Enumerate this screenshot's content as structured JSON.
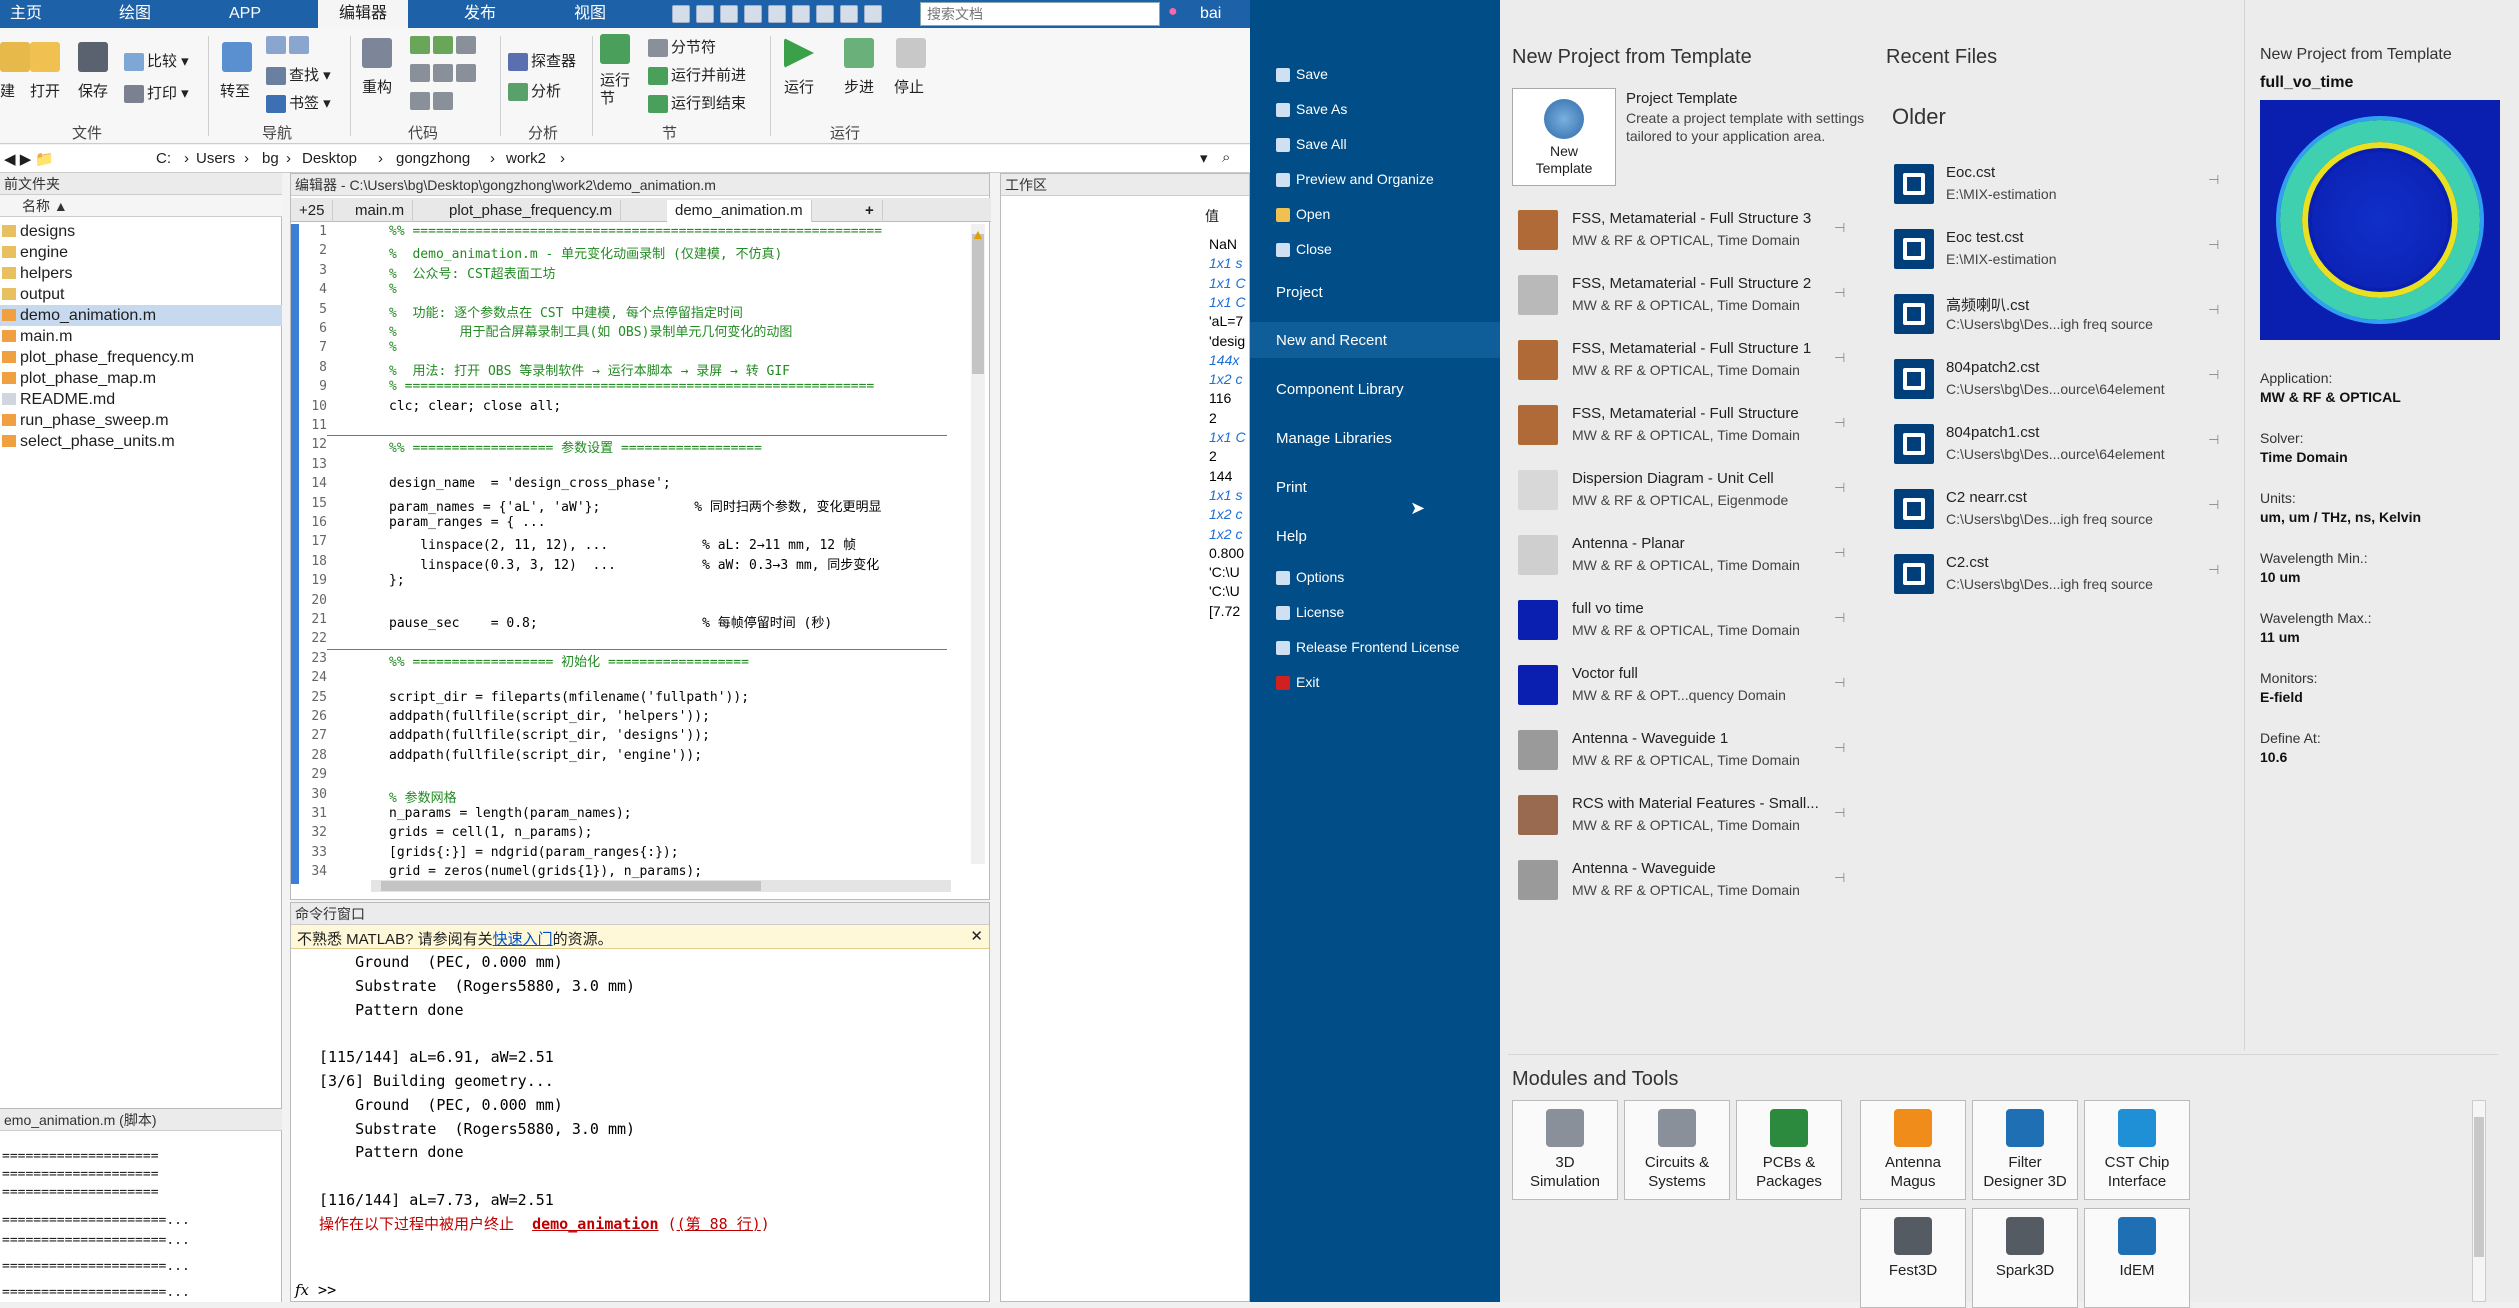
{
  "matlab": {
    "tabs": [
      "主页",
      "绘图",
      "APP",
      "编辑器",
      "发布",
      "视图"
    ],
    "search_placeholder": "搜索文档",
    "user": "bai",
    "ribbon": {
      "file": {
        "new": "建",
        "open": "打开",
        "save": "保存",
        "compare": "比较",
        "print": "打印",
        "group": "文件"
      },
      "nav": {
        "goto": "转至",
        "find": "查找",
        "bookmark": "书签",
        "group": "导航"
      },
      "code": {
        "refactor": "重构",
        "group": "代码"
      },
      "analyze": {
        "profiler": "探查器",
        "analyze": "分析",
        "group": "分析"
      },
      "section": {
        "run_section": "运行节",
        "section_break": "分节符",
        "run_advance": "运行并前进",
        "run_to_end": "运行到结束",
        "group": "节"
      },
      "run": {
        "run": "运行",
        "step": "步进",
        "stop": "停止",
        "group": "运行"
      }
    },
    "address": [
      "C:",
      "Users",
      "bg",
      "Desktop",
      "gongzhong",
      "work2"
    ],
    "files": {
      "header": "前文件夹",
      "col": "名称",
      "items": [
        "designs",
        "engine",
        "helpers",
        "output",
        "demo_animation.m",
        "main.m",
        "plot_phase_frequency.m",
        "plot_phase_map.m",
        "README.md",
        "run_phase_sweep.m",
        "select_phase_units.m"
      ]
    },
    "details": {
      "title": "emo_animation.m  (脚本)",
      "lines": [
        "====================",
        "====================",
        "====================",
        "=====================...",
        "=====================...",
        "=====================...",
        "=====================..."
      ]
    },
    "editor": {
      "title": "编辑器 - C:\\Users\\bg\\Desktop\\gongzhong\\work2\\demo_animation.m",
      "tabs": [
        "+25",
        "main.m",
        "plot_phase_frequency.m",
        "demo_animation.m"
      ],
      "lines": [
        {
          "n": "1",
          "t": "%% ============================================================",
          "c": "cm"
        },
        {
          "n": "2",
          "t": "%  demo_animation.m - 单元变化动画录制 (仅建模, 不仿真)",
          "c": "cm"
        },
        {
          "n": "3",
          "t": "%  公众号: CST超表面工坊",
          "c": "cm"
        },
        {
          "n": "4",
          "t": "%",
          "c": "cm"
        },
        {
          "n": "5",
          "t": "%  功能: 逐个参数点在 CST 中建模, 每个点停留指定时间",
          "c": "cm"
        },
        {
          "n": "6",
          "t": "%        用于配合屏幕录制工具(如 OBS)录制单元几何变化的动图",
          "c": "cm"
        },
        {
          "n": "7",
          "t": "%",
          "c": "cm"
        },
        {
          "n": "8",
          "t": "%  用法: 打开 OBS 等录制软件 → 运行本脚本 → 录屏 → 转 GIF",
          "c": "cm"
        },
        {
          "n": "9",
          "t": "% ============================================================",
          "c": "cm"
        },
        {
          "n": "10",
          "t": "clc; clear; close all;",
          "c": ""
        },
        {
          "n": "11",
          "t": "",
          "c": ""
        },
        {
          "n": "12",
          "t": "%% ================== 参数设置 ==================",
          "c": "cm"
        },
        {
          "n": "13",
          "t": "",
          "c": ""
        },
        {
          "n": "14",
          "t": "design_name  = 'design_cross_phase';",
          "c": ""
        },
        {
          "n": "15",
          "t": "param_names = {'aL', 'aW'};            % 同时扫两个参数, 变化更明显",
          "c": ""
        },
        {
          "n": "16",
          "t": "param_ranges = { ...",
          "c": ""
        },
        {
          "n": "17",
          "t": "    linspace(2, 11, 12), ...            % aL: 2→11 mm, 12 帧",
          "c": ""
        },
        {
          "n": "18",
          "t": "    linspace(0.3, 3, 12)  ...           % aW: 0.3→3 mm, 同步变化",
          "c": ""
        },
        {
          "n": "19",
          "t": "};",
          "c": ""
        },
        {
          "n": "20",
          "t": "",
          "c": ""
        },
        {
          "n": "21",
          "t": "pause_sec    = 0.8;                     % 每帧停留时间 (秒)",
          "c": ""
        },
        {
          "n": "22",
          "t": "",
          "c": ""
        },
        {
          "n": "23",
          "t": "%% ================== 初始化 ==================",
          "c": "cm"
        },
        {
          "n": "24",
          "t": "",
          "c": ""
        },
        {
          "n": "25",
          "t": "script_dir = fileparts(mfilename('fullpath'));",
          "c": ""
        },
        {
          "n": "26",
          "t": "addpath(fullfile(script_dir, 'helpers'));",
          "c": ""
        },
        {
          "n": "27",
          "t": "addpath(fullfile(script_dir, 'designs'));",
          "c": ""
        },
        {
          "n": "28",
          "t": "addpath(fullfile(script_dir, 'engine'));",
          "c": ""
        },
        {
          "n": "29",
          "t": "",
          "c": ""
        },
        {
          "n": "30",
          "t": "% 参数网格",
          "c": "cm"
        },
        {
          "n": "31",
          "t": "n_params = length(param_names);",
          "c": ""
        },
        {
          "n": "32",
          "t": "grids = cell(1, n_params);",
          "c": ""
        },
        {
          "n": "33",
          "t": "[grids{:}] = ndgrid(param_ranges{:});",
          "c": ""
        },
        {
          "n": "34",
          "t": "grid = zeros(numel(grids{1}), n_params);",
          "c": ""
        }
      ]
    },
    "command": {
      "title": "命令行窗口",
      "notice_pre": "不熟悉 MATLAB? 请参阅有关",
      "notice_link": "快速入门",
      "notice_post": "的资源。",
      "lines": [
        "    Ground  (PEC, 0.000 mm)",
        "    Substrate  (Rogers5880, 3.0 mm)",
        "    Pattern done",
        "",
        "[115/144] aL=6.91, aW=2.51",
        "[3/6] Building geometry...",
        "    Ground  (PEC, 0.000 mm)",
        "    Substrate  (Rogers5880, 3.0 mm)",
        "    Pattern done",
        "",
        "[116/144] aL=7.73, aW=2.51"
      ],
      "error_pre": "操作在以下过程中被用户终止",
      "error_fn": "demo_animation",
      "error_line": "(第 88 行)",
      "prompt": ">>"
    },
    "workspace": {
      "title": "工作区",
      "col": "值",
      "values": [
        {
          "v": "NaN",
          "k": "b"
        },
        {
          "v": "1x1 s",
          "k": "v"
        },
        {
          "v": "1x1 C",
          "k": "v"
        },
        {
          "v": "1x1 C",
          "k": "v"
        },
        {
          "v": "'aL=7",
          "k": "b"
        },
        {
          "v": "'desig",
          "k": "b"
        },
        {
          "v": "144x",
          "k": "v"
        },
        {
          "v": "1x2 c",
          "k": "v"
        },
        {
          "v": "116",
          "k": "b"
        },
        {
          "v": "2",
          "k": "b"
        },
        {
          "v": "1x1 C",
          "k": "v"
        },
        {
          "v": "2",
          "k": "b"
        },
        {
          "v": "144",
          "k": "b"
        },
        {
          "v": "1x1 s",
          "k": "v"
        },
        {
          "v": "1x2 c",
          "k": "v"
        },
        {
          "v": "1x2 c",
          "k": "v"
        },
        {
          "v": "0.800",
          "k": "b"
        },
        {
          "v": "'C:\\U",
          "k": "b"
        },
        {
          "v": "'C:\\U",
          "k": "b"
        },
        {
          "v": "[7.72",
          "k": "b"
        }
      ]
    }
  },
  "cst": {
    "menu": {
      "save": "Save",
      "save_as": "Save As",
      "save_all": "Save All",
      "preview": "Preview and Organize",
      "open": "Open",
      "close": "Close",
      "project": "Project",
      "new_recent": "New and Recent",
      "component_library": "Component Library",
      "manage_libraries": "Manage Libraries",
      "print": "Print",
      "help": "Help",
      "options": "Options",
      "license": "License",
      "release_license": "Release Frontend License",
      "exit": "Exit"
    },
    "templates_title": "New Project from Template",
    "new_template": {
      "label": "New Template",
      "title": "Project Template",
      "desc1": "Create a project template with settings",
      "desc2": "tailored to your application area."
    },
    "templates": [
      {
        "t": "FSS, Metamaterial - Full Structure 3",
        "s": "MW & RF & OPTICAL, Time Domain",
        "c": "#b06a38"
      },
      {
        "t": "FSS, Metamaterial - Full Structure 2",
        "s": "MW & RF & OPTICAL, Time Domain",
        "c": "#b9b9b9"
      },
      {
        "t": "FSS, Metamaterial - Full Structure 1",
        "s": "MW & RF & OPTICAL, Time Domain",
        "c": "#b06a38"
      },
      {
        "t": "FSS, Metamaterial - Full Structure",
        "s": "MW & RF & OPTICAL, Time Domain",
        "c": "#b06a38"
      },
      {
        "t": "Dispersion Diagram - Unit Cell",
        "s": "MW & RF & OPTICAL, Eigenmode",
        "c": "#d8d8d8"
      },
      {
        "t": "Antenna - Planar",
        "s": "MW & RF & OPTICAL, Time Domain",
        "c": "#cfcfcf"
      },
      {
        "t": "full vo time",
        "s": "MW & RF & OPTICAL, Time Domain",
        "c": "#0a1fb0"
      },
      {
        "t": "Voctor full",
        "s": "MW & RF & OPT...quency Domain",
        "c": "#0a1fb0"
      },
      {
        "t": "Antenna - Waveguide 1",
        "s": "MW & RF & OPTICAL, Time Domain",
        "c": "#9a9a9a"
      },
      {
        "t": "RCS with Material Features - Small...",
        "s": "MW & RF & OPTICAL, Time Domain",
        "c": "#9a6a50"
      },
      {
        "t": "Antenna - Waveguide",
        "s": "MW & RF & OPTICAL, Time Domain",
        "c": "#9a9a9a"
      }
    ],
    "recent_title": "Recent Files",
    "older_label": "Older",
    "recent": [
      {
        "t": "Eoc.cst",
        "s": "E:\\MIX-estimation"
      },
      {
        "t": "Eoc test.cst",
        "s": "E:\\MIX-estimation"
      },
      {
        "t": "高频喇叭.cst",
        "s": "C:\\Users\\bg\\Des...igh freq source"
      },
      {
        "t": "804patch2.cst",
        "s": "C:\\Users\\bg\\Des...ource\\64element"
      },
      {
        "t": "804patch1.cst",
        "s": "C:\\Users\\bg\\Des...ource\\64element"
      },
      {
        "t": "C2 nearr.cst",
        "s": "C:\\Users\\bg\\Des...igh freq source"
      },
      {
        "t": "C2.cst",
        "s": "C:\\Users\\bg\\Des...igh freq source"
      }
    ],
    "detail": {
      "header": "New Project from Template",
      "name": "full_vo_time",
      "fields": [
        {
          "l": "Application:",
          "v": "MW & RF & OPTICAL"
        },
        {
          "l": "Solver:",
          "v": "Time Domain"
        },
        {
          "l": "Units:",
          "v": "um, um / THz, ns, Kelvin"
        },
        {
          "l": "Wavelength Min.:",
          "v": "10 um"
        },
        {
          "l": "Wavelength Max.:",
          "v": "11 um"
        },
        {
          "l": "Monitors:",
          "v": "E-field"
        },
        {
          "l": "Define At:",
          "v": "10.6"
        }
      ]
    },
    "modules_title": "Modules and Tools",
    "tools": [
      {
        "t": "3D Simulation",
        "c": "#8a9099"
      },
      {
        "t": "Circuits & Systems",
        "c": "#8a9099"
      },
      {
        "t": "PCBs & Packages",
        "c": "#2b8a3e"
      },
      {
        "t": "Antenna Magus",
        "c": "#f08c1a"
      },
      {
        "t": "Filter Designer 3D",
        "c": "#1f6fb5"
      },
      {
        "t": "CST Chip Interface",
        "c": "#1f8fd6"
      },
      {
        "t": "Fest3D",
        "c": "#555b63"
      },
      {
        "t": "Spark3D",
        "c": "#555b63"
      },
      {
        "t": "IdEM",
        "c": "#1f6fb5"
      }
    ]
  }
}
